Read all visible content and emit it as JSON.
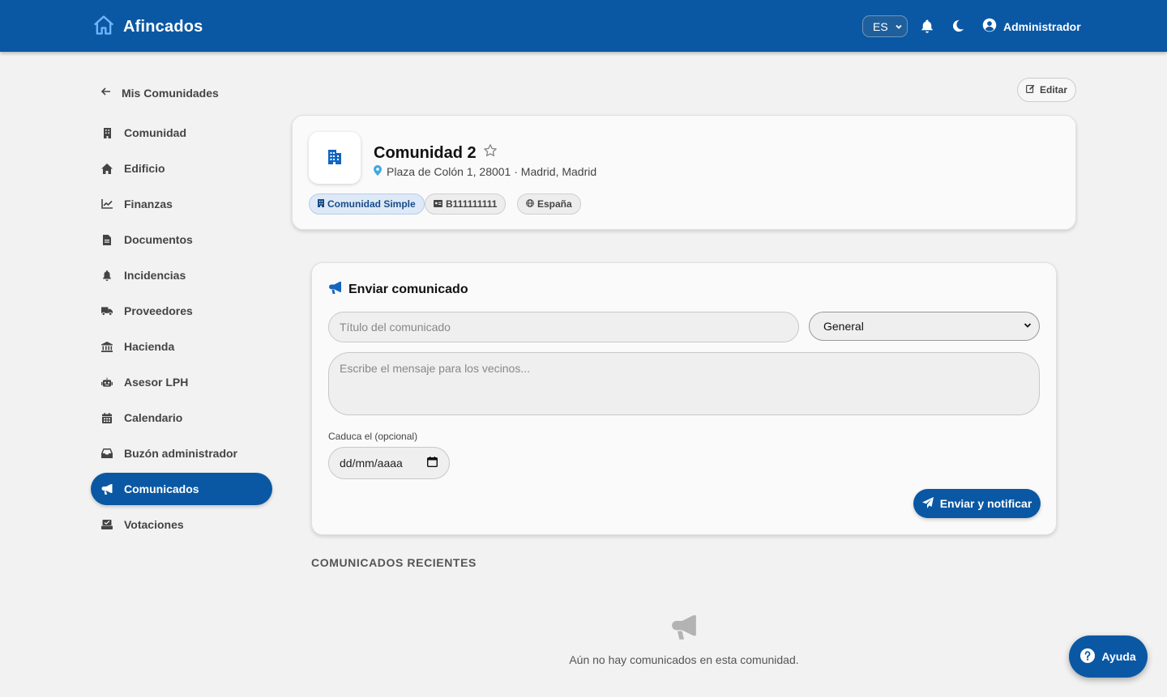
{
  "header": {
    "brand": "Afincados",
    "language": "ES",
    "user_name": "Administrador"
  },
  "sidebar": {
    "back_label": "Mis Comunidades",
    "items": [
      {
        "label": "Comunidad",
        "icon": "building-icon"
      },
      {
        "label": "Edificio",
        "icon": "home-icon"
      },
      {
        "label": "Finanzas",
        "icon": "chart-line-icon"
      },
      {
        "label": "Documentos",
        "icon": "file-icon"
      },
      {
        "label": "Incidencias",
        "icon": "bell-icon"
      },
      {
        "label": "Proveedores",
        "icon": "truck-icon"
      },
      {
        "label": "Hacienda",
        "icon": "bank-icon"
      },
      {
        "label": "Asesor LPH",
        "icon": "robot-icon"
      },
      {
        "label": "Calendario",
        "icon": "calendar-icon"
      },
      {
        "label": "Buzón administrador",
        "icon": "inbox-icon"
      },
      {
        "label": "Comunicados",
        "icon": "megaphone-icon",
        "active": true
      },
      {
        "label": "Votaciones",
        "icon": "vote-icon"
      }
    ]
  },
  "toolbar": {
    "edit_label": "Editar"
  },
  "community": {
    "name": "Comunidad 2",
    "address": "Plaza de Colón 1, 28001 · Madrid, Madrid",
    "chips": {
      "type": "Comunidad Simple",
      "cif": "B111111111",
      "country": "España"
    }
  },
  "send_form": {
    "title": "Enviar comunicado",
    "title_placeholder": "Título del comunicado",
    "category_selected": "General",
    "message_placeholder": "Escribe el mensaje para los vecinos...",
    "expiry_label": "Caduca el (opcional)",
    "date_placeholder": "dd/mm/aaaa",
    "submit_label": "Enviar y notificar"
  },
  "recent": {
    "title": "COMUNICADOS RECIENTES",
    "empty_text": "Aún no hay comunicados en esta comunidad."
  },
  "help": {
    "label": "Ayuda"
  },
  "colors": {
    "primary": "#0a58a4",
    "accent_icon": "#1565c0",
    "background": "#f2f2f2"
  }
}
